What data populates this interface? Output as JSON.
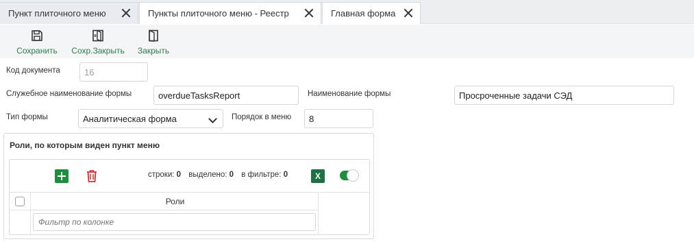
{
  "tabs": [
    {
      "label": "Пункт плиточного меню"
    },
    {
      "label": "Пункты плиточного меню - Реестр"
    },
    {
      "label": "Главная форма"
    }
  ],
  "toolbar": {
    "save_label": "Сохранить",
    "saveclose_label": "Сохр.Закрыть",
    "close_label": "Закрыть"
  },
  "form": {
    "doc_code_label": "Код документа",
    "doc_code_value": "16",
    "service_name_label": "Служебное наименование формы",
    "service_name_value": "overdueTasksReport",
    "form_name_label": "Наименование формы",
    "form_name_value": "Просроченные задачи СЭД",
    "form_type_label": "Тип формы",
    "form_type_value": "Аналитическая форма",
    "menu_order_label": "Порядок в меню",
    "menu_order_value": "8"
  },
  "roles_panel": {
    "title": "Роли, по которым виден пункт меню",
    "stats": {
      "rows_label": "строки:",
      "rows_value": "0",
      "selected_label": "выделено:",
      "selected_value": "0",
      "filter_label": "в фильтре:",
      "filter_value": "0"
    },
    "excel_label": "X",
    "column_header": "Роли",
    "filter_placeholder": "Фильтр по колонке"
  },
  "colors": {
    "accent_green": "#1e8e3e",
    "label_green": "#2e7d4a",
    "delete_red": "#d32f2f",
    "excel_green": "#1e7145"
  },
  "icons": {
    "save": "save-icon",
    "saveclose": "save-close-icon",
    "close": "door-exit-icon",
    "add": "plus-icon",
    "delete": "trash-icon",
    "excel": "excel-icon"
  }
}
